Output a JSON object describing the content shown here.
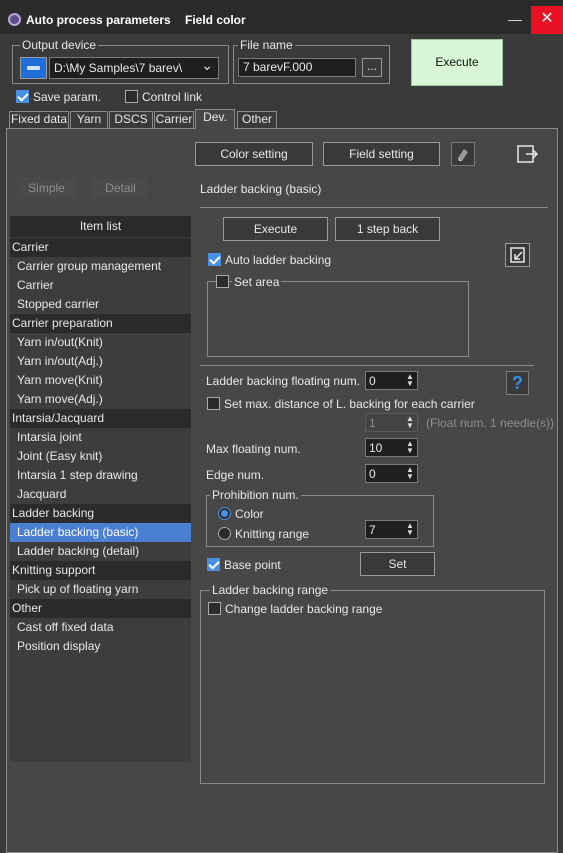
{
  "window": {
    "title": "Auto process parameters",
    "subtitle": "Field color",
    "minimize_glyph": "—",
    "close_glyph": "✕"
  },
  "output_device": {
    "group_label": "Output device",
    "path": "D:\\My Samples\\7 barev\\",
    "dropdown_glyph": "⌄"
  },
  "file_name": {
    "group_label": "File name",
    "value": "7 barevF.000",
    "browse_label": "..."
  },
  "execute_top_label": "Execute",
  "options": {
    "save_param": {
      "label": "Save param.",
      "checked": true
    },
    "control_link": {
      "label": "Control link",
      "checked": false
    }
  },
  "tabs": [
    {
      "label": "Fixed data",
      "active": false
    },
    {
      "label": "Yarn",
      "active": false
    },
    {
      "label": "DSCS",
      "active": false
    },
    {
      "label": "Carrier",
      "active": false
    },
    {
      "label": "Dev.",
      "active": true
    },
    {
      "label": "Other",
      "active": false
    }
  ],
  "toolbar": {
    "color_setting": "Color setting",
    "field_setting": "Field setting"
  },
  "mode_buttons": {
    "simple": "Simple",
    "detail": "Detail"
  },
  "item_list": {
    "header": "Item list",
    "entries": [
      {
        "label": "Carrier",
        "type": "category"
      },
      {
        "label": "Carrier group management",
        "type": "item"
      },
      {
        "label": "Carrier",
        "type": "item"
      },
      {
        "label": "Stopped carrier",
        "type": "item"
      },
      {
        "label": "Carrier preparation",
        "type": "category"
      },
      {
        "label": "Yarn in/out(Knit)",
        "type": "item"
      },
      {
        "label": "Yarn in/out(Adj.)",
        "type": "item"
      },
      {
        "label": "Yarn move(Knit)",
        "type": "item"
      },
      {
        "label": "Yarn move(Adj.)",
        "type": "item"
      },
      {
        "label": "Intarsia/Jacquard",
        "type": "category"
      },
      {
        "label": "Intarsia joint",
        "type": "item"
      },
      {
        "label": "Joint (Easy knit)",
        "type": "item"
      },
      {
        "label": "Intarsia 1 step drawing",
        "type": "item"
      },
      {
        "label": "Jacquard",
        "type": "item"
      },
      {
        "label": "Ladder backing",
        "type": "category"
      },
      {
        "label": "Ladder backing (basic)",
        "type": "item",
        "selected": true
      },
      {
        "label": "Ladder backing (detail)",
        "type": "item"
      },
      {
        "label": "Knitting support",
        "type": "category"
      },
      {
        "label": "Pick up of floating yarn",
        "type": "item"
      },
      {
        "label": "Other",
        "type": "category"
      },
      {
        "label": "Cast off fixed data",
        "type": "item"
      },
      {
        "label": "Position display",
        "type": "item"
      }
    ]
  },
  "detail": {
    "section_title": "Ladder backing (basic)",
    "execute": "Execute",
    "one_step_back": "1 step back",
    "auto_ladder_backing": {
      "label": "Auto ladder backing",
      "checked": true
    },
    "set_area": {
      "label": "Set area",
      "checked": false
    },
    "floating_num": {
      "label": "Ladder backing floating num.",
      "value": "0"
    },
    "help_glyph": "?",
    "set_max_distance": {
      "label": "Set max. distance of L. backing for each carrier",
      "checked": false
    },
    "float_num_value": "1",
    "float_num_hint": "(Float num. 1 needle(s))",
    "max_floating_num": {
      "label": "Max floating num.",
      "value": "10"
    },
    "edge_num": {
      "label": "Edge num.",
      "value": "0"
    },
    "prohibition": {
      "group_label": "Prohibition num.",
      "color": {
        "label": "Color",
        "selected": true
      },
      "knitting_range": {
        "label": "Knitting range",
        "selected": false,
        "value": "7"
      }
    },
    "base_point": {
      "label": "Base point",
      "checked": true,
      "set_label": "Set"
    },
    "range_group": {
      "group_label": "Ladder backing range",
      "change_range": {
        "label": "Change ladder backing range",
        "checked": false
      }
    }
  },
  "colors": {
    "window_bg": "#3a3a3a",
    "panel_bg": "#474747",
    "accent": "#4a90e2",
    "selection": "#4a7fd1",
    "execute_bg": "#d7f7d7",
    "close_red": "#e81123",
    "help_blue": "#2f8fe8"
  },
  "icons": [
    "app-icon",
    "drive-icon",
    "chevron-down-icon",
    "eraser-icon",
    "export-icon",
    "import-icon",
    "help-icon"
  ]
}
